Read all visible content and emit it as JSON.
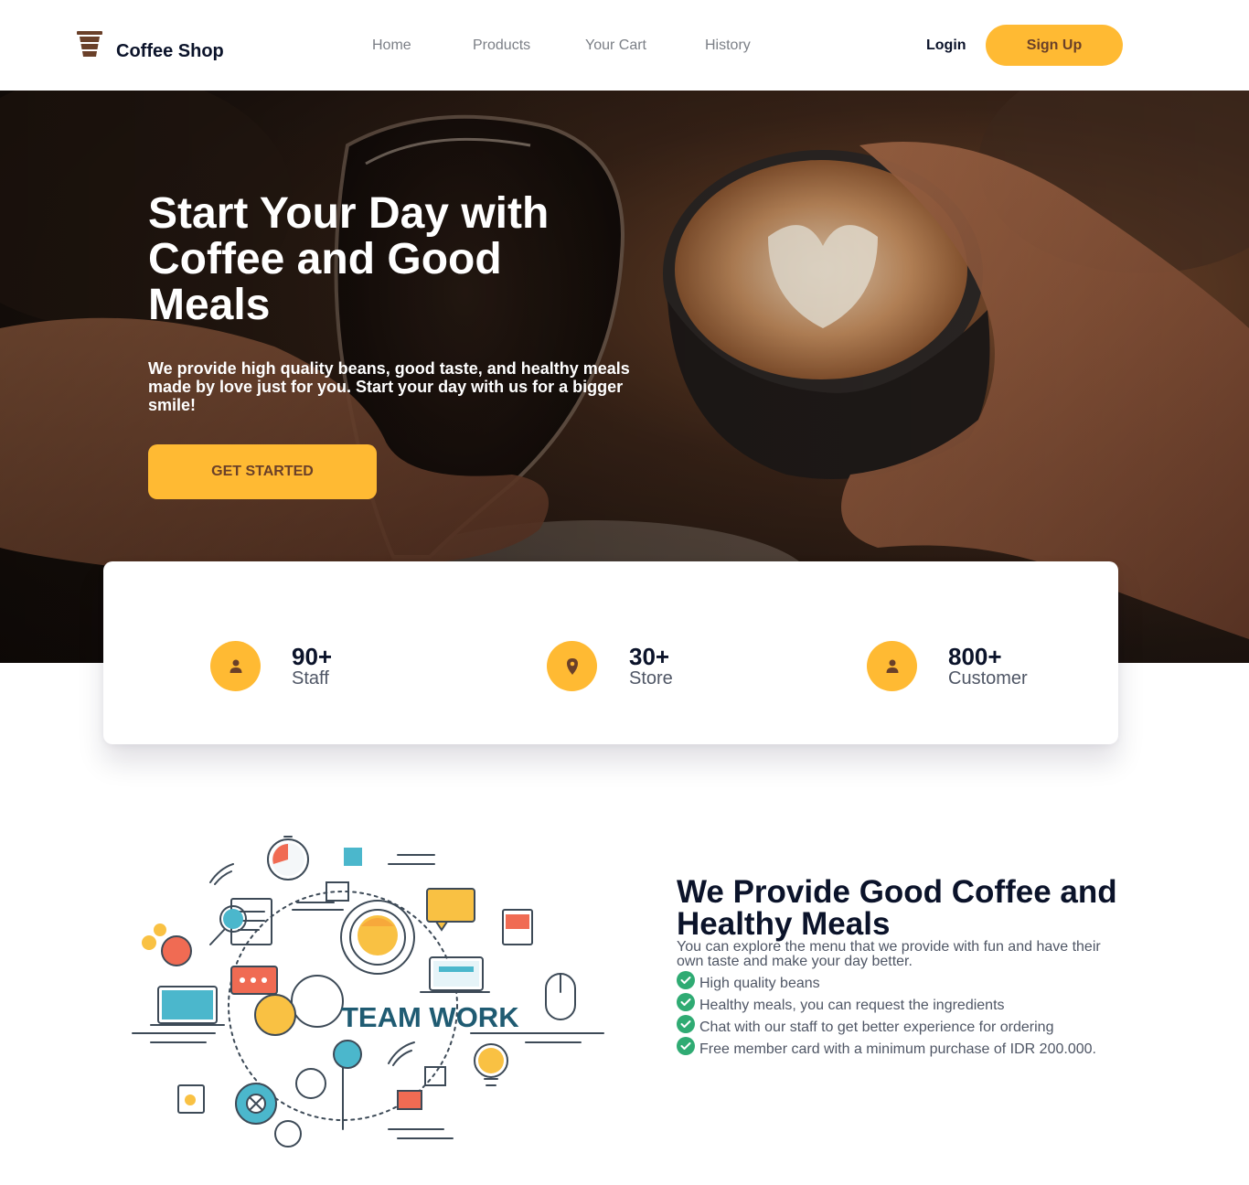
{
  "navbar": {
    "brand": "Coffee Shop",
    "links": [
      "Home",
      "Products",
      "Your Cart",
      "History"
    ],
    "login": "Login",
    "signup": "Sign Up"
  },
  "hero": {
    "title": "Start Your Day with Coffee and Good Meals",
    "subtitle": "We provide high quality beans, good taste, and healthy meals made by love just for you. Start your day with us for a bigger smile!",
    "cta": "GET STARTED"
  },
  "stats": [
    {
      "value": "90+",
      "label": "Staff",
      "icon": "user-icon"
    },
    {
      "value": "30+",
      "label": "Store",
      "icon": "location-pin-icon"
    },
    {
      "value": "800+",
      "label": "Customer",
      "icon": "user-icon"
    }
  ],
  "feature": {
    "illustration_text": "TEAM WORK",
    "title": "We Provide Good Coffee and Healthy Meals",
    "description": "You can explore the menu that we provide with fun and have their own taste and make your day better.",
    "items": [
      "High quality beans",
      "Healthy meals, you can request the ingredients",
      "Chat with our staff to get better experience for ordering",
      "Free member card with a minimum purchase of IDR 200.000."
    ]
  },
  "colors": {
    "accent": "#ffba33",
    "brown": "#6a4029",
    "heading": "#0b132a",
    "text": "#4f5665",
    "check": "#2fab73"
  }
}
